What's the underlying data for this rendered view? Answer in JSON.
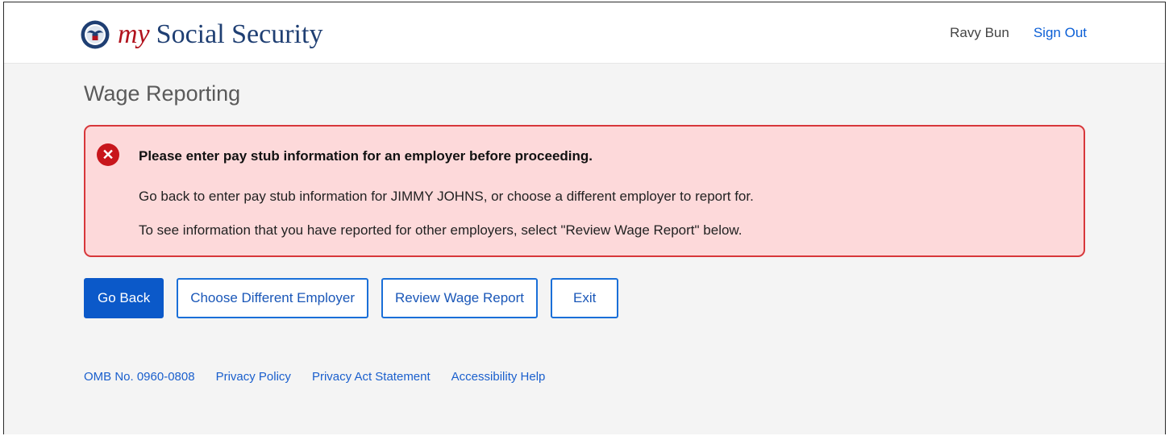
{
  "header": {
    "brand_prefix": "my",
    "brand_name": "Social Security",
    "seal_icon": "ssa-seal-icon",
    "user_name": "Ravy Bun",
    "sign_out_label": "Sign Out"
  },
  "page": {
    "title": "Wage Reporting"
  },
  "alert": {
    "icon": "error-x-icon",
    "title": "Please enter pay stub information for an employer before proceeding.",
    "line1": "Go back to enter pay stub information for JIMMY JOHNS, or choose a different employer to report for.",
    "line2": "To see information that you have reported for other employers, select \"Review Wage Report\" below."
  },
  "actions": {
    "go_back": "Go Back",
    "choose_employer": "Choose Different Employer",
    "review_report": "Review Wage Report",
    "exit": "Exit"
  },
  "footer": {
    "omb": "OMB No. 0960-0808",
    "privacy_policy": "Privacy Policy",
    "privacy_act": "Privacy Act Statement",
    "accessibility": "Accessibility Help"
  },
  "colors": {
    "brand_red": "#b1121d",
    "brand_blue": "#1f3f73",
    "link_blue": "#0b5fd6",
    "primary_button": "#0b59c9",
    "alert_bg": "#fdd9da",
    "alert_border": "#d7373a",
    "alert_icon": "#c8161c",
    "page_bg": "#f4f4f4"
  }
}
